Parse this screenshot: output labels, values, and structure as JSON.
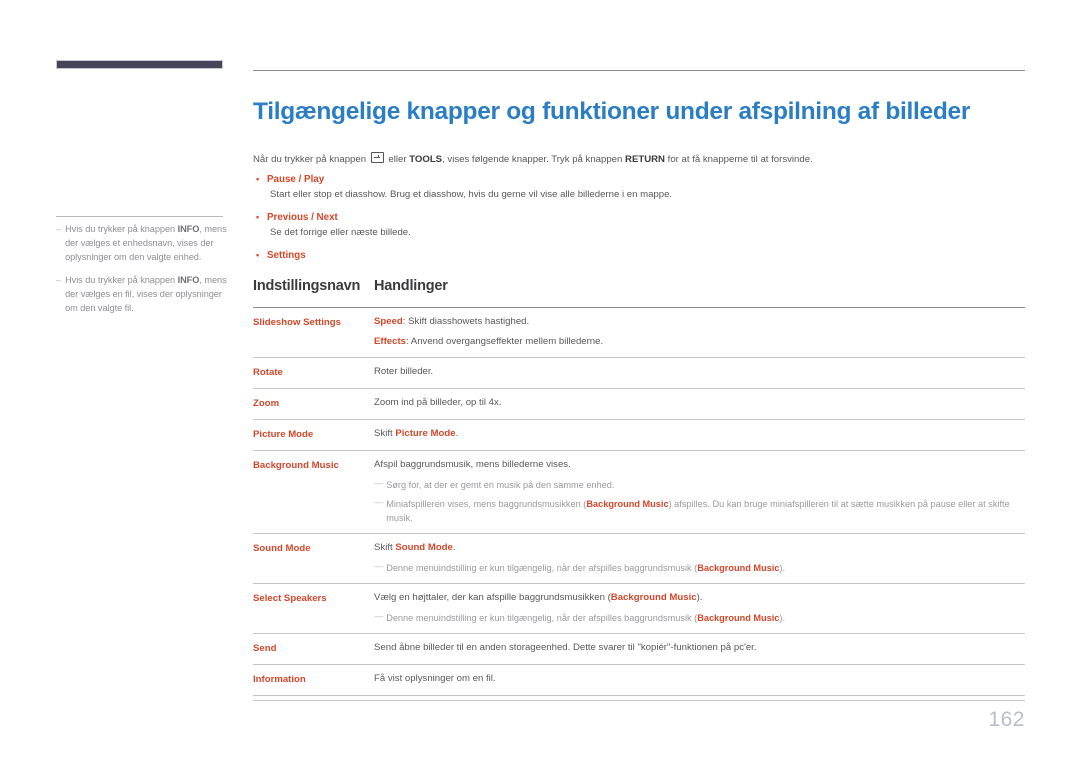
{
  "document": {
    "page_number": "162",
    "title": "Tilgængelige knapper og funktioner under afspilning af billeder",
    "accent_blue": "#2b7dc4",
    "accent_orange": "#d4472a",
    "nav_bar_color": "#464459"
  },
  "sidebar": {
    "notes": [
      {
        "dash": "–",
        "pre": "Hvis du trykker på knappen ",
        "bold": "INFO",
        "post": ", mens der vælges et enhedsnavn, vises der oplysninger om den valgte enhed."
      },
      {
        "dash": "–",
        "pre": "Hvis du trykker på knappen ",
        "bold": "INFO",
        "post": ", mens der vælges en fil, vises der oplysninger om den valgte fil."
      }
    ]
  },
  "intro": {
    "part1": "Når du trykker på knappen ",
    "icon": "enter-key-icon",
    "part2": " eller ",
    "bold1": "TOOLS",
    "part3": ", vises følgende knapper. Tryk på knappen ",
    "bold2": "RETURN",
    "part4": " for at få knapperne til at forsvinde."
  },
  "bullets": [
    {
      "dot": "•",
      "label": "Pause / Play",
      "desc": "Start eller stop et diasshow. Brug et diasshow, hvis du gerne vil vise alle billederne i en mappe."
    },
    {
      "dot": "•",
      "label": "Previous / Next",
      "desc": "Se det forrige eller næste billede."
    },
    {
      "dot": "•",
      "label": "Settings",
      "desc": ""
    }
  ],
  "table": {
    "headers": {
      "col1": "Indstillingsnavn",
      "col2": "Handlinger"
    },
    "rows": [
      {
        "name": "Slideshow Settings",
        "lines": [
          {
            "kw": "Speed",
            "text": ": Skift diasshowets hastighed."
          },
          {
            "kw": "Effects",
            "text": ": Anvend overgangseffekter mellem billederne."
          }
        ],
        "notes": []
      },
      {
        "name": "Rotate",
        "lines": [
          {
            "kw": "",
            "text": "Roter billeder."
          }
        ],
        "notes": []
      },
      {
        "name": "Zoom",
        "lines": [
          {
            "kw": "",
            "text": "Zoom ind på billeder, op til 4x."
          }
        ],
        "notes": []
      },
      {
        "name": "Picture Mode",
        "lines": [
          {
            "kw": "",
            "text": "Skift ",
            "kw_after": "Picture Mode",
            "text_after": "."
          }
        ],
        "notes": []
      },
      {
        "name": "Background Music",
        "lines": [
          {
            "kw": "",
            "text": "Afspil baggrundsmusik, mens billederne vises."
          }
        ],
        "notes": [
          {
            "dash": "—",
            "pre": "Sørg for, at der er gemt en musik på den samme enhed.",
            "bold": "",
            "post": ""
          },
          {
            "dash": "—",
            "pre": "Miniafspilleren vises, mens baggrundsmusikken (",
            "bold": "Background Music",
            "post": ") afspilles. Du kan bruge miniafspilleren til at sætte musikken på pause eller at skifte musik."
          }
        ]
      },
      {
        "name": "Sound Mode",
        "lines": [
          {
            "kw": "",
            "text": "Skift ",
            "kw_after": "Sound Mode",
            "text_after": "."
          }
        ],
        "notes": [
          {
            "dash": "—",
            "pre": "Denne menuindstilling er kun tilgængelig, når der afspilles baggrundsmusik (",
            "bold": "Background Music",
            "post": ")."
          }
        ]
      },
      {
        "name": "Select Speakers",
        "lines": [
          {
            "kw": "",
            "text": "Vælg en højttaler, der kan afspille baggrundsmusikken (",
            "kw_after": "Background Music",
            "text_after": ")."
          }
        ],
        "notes": [
          {
            "dash": "—",
            "pre": "Denne menuindstilling er kun tilgængelig, når der afspilles baggrundsmusik (",
            "bold": "Background Music",
            "post": ")."
          }
        ]
      },
      {
        "name": "Send",
        "lines": [
          {
            "kw": "",
            "text": "Send åbne billeder til en anden storageenhed. Dette svarer til \"kopiér\"-funktionen på pc'er."
          }
        ],
        "notes": []
      },
      {
        "name": "Information",
        "lines": [
          {
            "kw": "",
            "text": "Få vist oplysninger om en fil."
          }
        ],
        "notes": []
      }
    ]
  }
}
